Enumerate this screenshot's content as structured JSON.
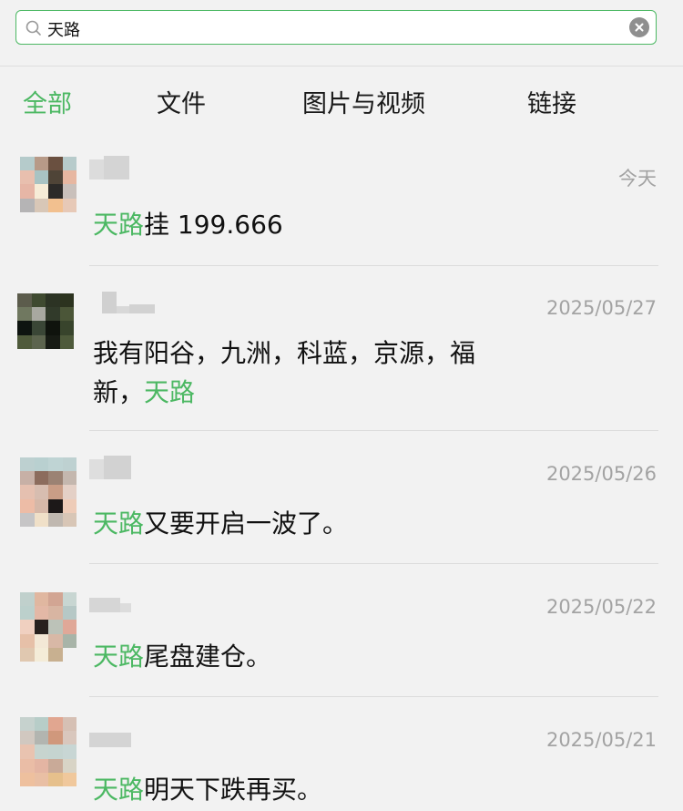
{
  "search": {
    "value": "天路"
  },
  "tabs": [
    {
      "label": "全部",
      "active": true
    },
    {
      "label": "文件",
      "active": false
    },
    {
      "label": "图片与视频",
      "active": false
    },
    {
      "label": "链接",
      "active": false
    }
  ],
  "results": [
    {
      "time": "今天",
      "highlight": "天路",
      "text": "挂 199.666",
      "avatar_colors": [
        "#b5cbcb",
        "#b79a88",
        "#6a5040",
        "#b7cbcb",
        "#e8bfae",
        "#a8c3c3",
        "#4f4437",
        "#e7b7a1",
        "#e6b6a6",
        "#f6ecd7",
        "#2c2a28",
        "#c9c0bb",
        "#b5b4b5",
        "#d8c7b7",
        "#f2c08f",
        "#e7c9b7",
        "#f2f2f2",
        "#f2f2f2",
        "#f2f2f2",
        "#f2f2f2"
      ]
    },
    {
      "time": "2025/05/27",
      "highlight": "天路",
      "text_before": "我有阳谷，九洲，科蓝，京源，福新，",
      "avatar_colors": [
        "#5c5c4c",
        "#3f4a30",
        "#2c3324",
        "#2c331f",
        "#707860",
        "#a8a8a0",
        "#313a2a",
        "#4b5638",
        "#0e1410",
        "#3a4636",
        "#0f130d",
        "#38442c",
        "#4f5a3b",
        "#5c644e",
        "#171b14",
        "#4e5a3b",
        "#f2f2f2",
        "#f2f2f2",
        "#f2f2f2",
        "#f2f2f2"
      ]
    },
    {
      "time": "2025/05/26",
      "highlight": "天路",
      "text": "又要开启一波了。",
      "avatar_colors": [
        "#bdd0d0",
        "#b9d0d0",
        "#bfd4d4",
        "#bed1d1",
        "#c7b0a6",
        "#8c6c5d",
        "#9b8273",
        "#c4b7ae",
        "#e5c0b0",
        "#d7bdb0",
        "#c99d86",
        "#e4d0c6",
        "#edbca6",
        "#d6b8a8",
        "#1c1818",
        "#eeccb8",
        "#c6c5c6",
        "#f0e0c8",
        "#c0b8b0",
        "#d8c6b6"
      ]
    },
    {
      "time": "2025/05/22",
      "highlight": "天路",
      "text": "尾盘建仓。",
      "avatar_colors": [
        "#c0d0cc",
        "#e0b7a0",
        "#d2a593",
        "#c8d6d2",
        "#bcd0cc",
        "#e3b8a6",
        "#d8b5a2",
        "#b6c8c6",
        "#f0d0c0",
        "#28211e",
        "#bcc2b8",
        "#e0a898",
        "#e6c0a8",
        "#f3e8d6",
        "#d8b8a6",
        "#a8b4a8",
        "#e0c8b0",
        "#f4ecd8",
        "#c8b090",
        "#f2f2f2"
      ]
    },
    {
      "time": "2025/05/21",
      "highlight": "天路",
      "text": "明天下跌再买。",
      "avatar_colors": [
        "#c6d2ce",
        "#b7cdc8",
        "#e1a690",
        "#d6c0b4",
        "#d1c8c0",
        "#b2b5b0",
        "#d0987c",
        "#d9c7bd",
        "#e9c3b0",
        "#c7d4cf",
        "#c5d4d0",
        "#c8d6d4",
        "#eabda6",
        "#e4b5a3",
        "#c9aa98",
        "#d8d4c6",
        "#eec09e",
        "#e9bfa4",
        "#e6c08c",
        "#f0c89c"
      ]
    }
  ]
}
